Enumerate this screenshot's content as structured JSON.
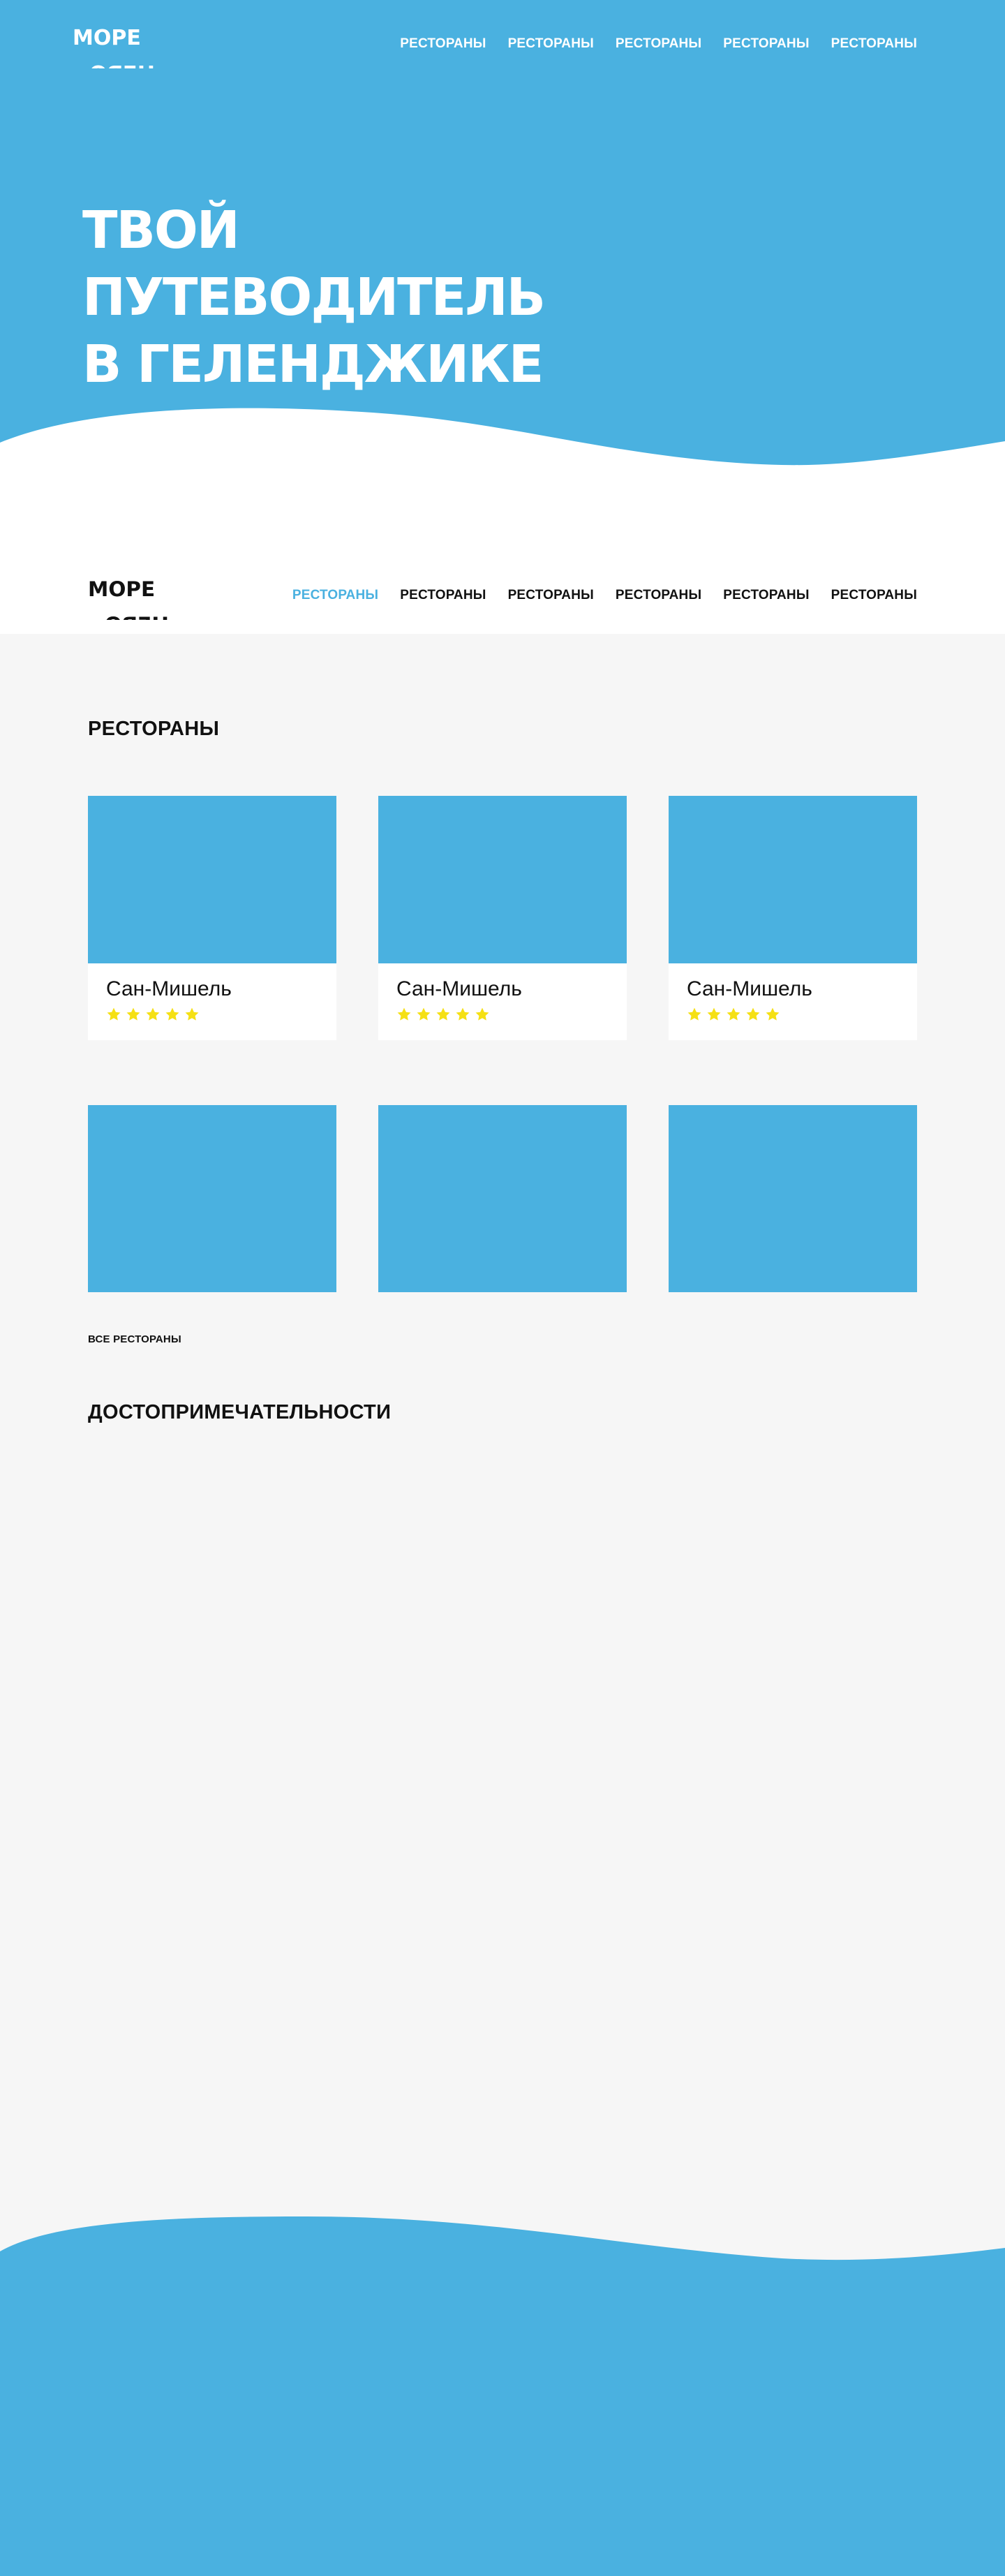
{
  "brand": {
    "logo_top": "МОРЕ",
    "logo_bottom": "НЕБО",
    "accent_color": "#4ab1e0",
    "star_color": "#f5e014"
  },
  "hero": {
    "nav": [
      "РЕСТОРАНЫ",
      "РЕСТОРАНЫ",
      "РЕСТОРАНЫ",
      "РЕСТОРАНЫ",
      "РЕСТОРАНЫ"
    ],
    "title_line1": "ТВОЙ ПУТЕВОДИТЕЛЬ",
    "title_line2": "В ГЕЛЕНДЖИКЕ"
  },
  "header": {
    "nav": [
      "РЕСТОРАНЫ",
      "РЕСТОРАНЫ",
      "РЕСТОРАНЫ",
      "РЕСТОРАНЫ",
      "РЕСТОРАНЫ",
      "РЕСТОРАНЫ"
    ],
    "active_index": 0
  },
  "restaurants": {
    "title": "РЕСТОРАНЫ",
    "cards": [
      {
        "name": "Сан-Мишель",
        "rating": 5
      },
      {
        "name": "Сан-Мишель",
        "rating": 5
      },
      {
        "name": "Сан-Мишель",
        "rating": 5
      }
    ],
    "all_link": "ВСЕ РЕСТОРАНЫ"
  },
  "sights": {
    "title": "ДОСТОПРИМЕЧАТЕЛЬНОСТИ"
  }
}
